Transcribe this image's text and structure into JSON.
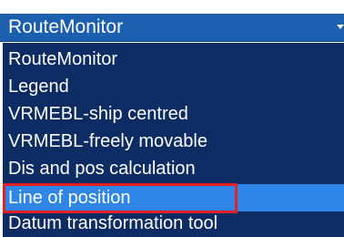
{
  "combo": {
    "selected_value": "RouteMonitor",
    "arrow_icon": "chevron-down-icon"
  },
  "options": [
    {
      "label": "RouteMonitor",
      "selected": false
    },
    {
      "label": "Legend",
      "selected": false
    },
    {
      "label": "VRMEBL-ship centred",
      "selected": false
    },
    {
      "label": "VRMEBL-freely movable",
      "selected": false
    },
    {
      "label": "Dis and pos calculation",
      "selected": false
    },
    {
      "label": "Line of position",
      "selected": true
    },
    {
      "label": "Datum transformation tool",
      "selected": false
    }
  ],
  "colors": {
    "header_bg": "#1b5fae",
    "list_bg": "#0c2c63",
    "hover_bg": "#2f86e6",
    "annotation_border": "#e32228",
    "text": "#ffffff"
  }
}
